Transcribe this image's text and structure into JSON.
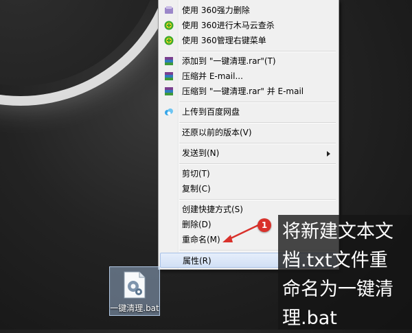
{
  "menu": {
    "items": [
      {
        "label": "使用 360强力删除",
        "icon": "360-shred-icon"
      },
      {
        "label": "使用 360进行木马云查杀",
        "icon": "360-scan-icon"
      },
      {
        "label": "使用 360管理右键菜单",
        "icon": "360-manage-icon"
      },
      {
        "label": "添加到 \"一键清理.rar\"(T)",
        "icon": "winrar-icon"
      },
      {
        "label": "压缩并 E-mail...",
        "icon": "winrar-icon"
      },
      {
        "label": "压缩到 \"一键清理.rar\" 并 E-mail",
        "icon": "winrar-icon"
      },
      {
        "label": "上传到百度网盘",
        "icon": "baidu-netdisk-icon"
      },
      {
        "label": "还原以前的版本(V)"
      },
      {
        "label": "发送到(N)"
      },
      {
        "label": "剪切(T)"
      },
      {
        "label": "复制(C)"
      },
      {
        "label": "创建快捷方式(S)"
      },
      {
        "label": "删除(D)"
      },
      {
        "label": "重命名(M)"
      },
      {
        "label": "属性(R)"
      }
    ]
  },
  "desktop_file": {
    "label": "一键清理.bat",
    "icon": "batch-file-gear-icon"
  },
  "annotation": {
    "badge": "1",
    "text": "将新建文本文\n档.txt文件重\n命名为一键清\n理.bat"
  },
  "colors": {
    "badge": "#d9312b",
    "highlight": "#d2e0f5",
    "menu_bg": "#f0f0f0"
  }
}
